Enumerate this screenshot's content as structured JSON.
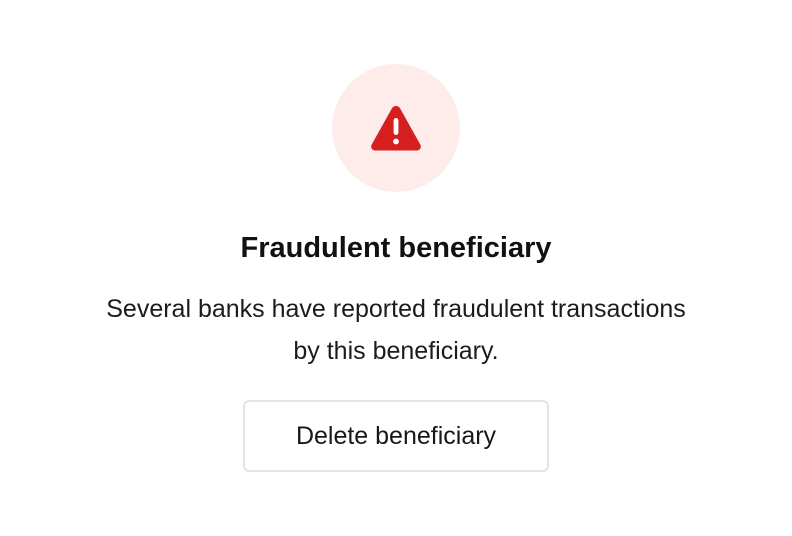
{
  "alert": {
    "icon": "warning-triangle-icon",
    "icon_color": "#d61f1f",
    "icon_background": "#fdecea",
    "title": "Fraudulent beneficiary",
    "message": "Several banks have reported fraudulent transactions by this beneficiary.",
    "delete_label": "Delete beneficiary"
  }
}
